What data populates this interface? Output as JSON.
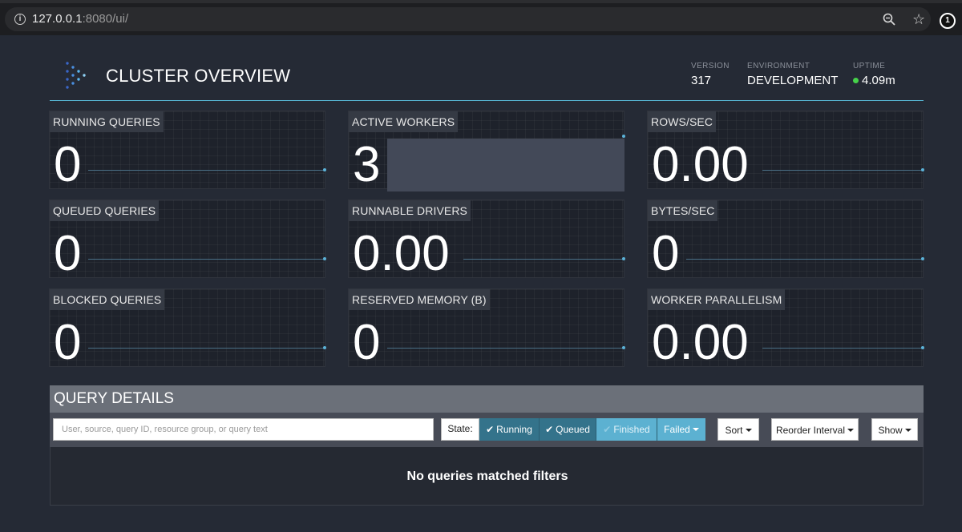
{
  "browser": {
    "url_host": "127.0.0.1",
    "url_rest": ":8080/ui/",
    "info_icon": "info-icon",
    "zoom_icon": "zoom-icon",
    "star_icon": "star-icon",
    "profile_badge": "1"
  },
  "header": {
    "title": "CLUSTER OVERVIEW",
    "version_label": "VERSION",
    "version_value": "317",
    "environment_label": "ENVIRONMENT",
    "environment_value": "DEVELOPMENT",
    "uptime_label": "UPTIME",
    "uptime_value": "4.09m",
    "accent_color": "#57b8d6",
    "uptime_status_color": "#46d24a"
  },
  "stats": [
    {
      "label": "RUNNING QUERIES",
      "value": "0"
    },
    {
      "label": "ACTIVE WORKERS",
      "value": "3"
    },
    {
      "label": "ROWS/SEC",
      "value": "0.00"
    },
    {
      "label": "QUEUED QUERIES",
      "value": "0"
    },
    {
      "label": "RUNNABLE DRIVERS",
      "value": "0.00"
    },
    {
      "label": "BYTES/SEC",
      "value": "0"
    },
    {
      "label": "BLOCKED QUERIES",
      "value": "0"
    },
    {
      "label": "RESERVED MEMORY (B)",
      "value": "0"
    },
    {
      "label": "WORKER PARALLELISM",
      "value": "0.00"
    }
  ],
  "query_details": {
    "title": "QUERY DETAILS",
    "search_placeholder": "User, source, query ID, resource group, or query text",
    "search_value": "",
    "state_label": "State:",
    "state_running": "Running",
    "state_queued": "Queued",
    "state_finished": "Finished",
    "state_failed": "Failed",
    "sort_label": "Sort",
    "reorder_label": "Reorder Interval",
    "show_label": "Show",
    "empty_message": "No queries matched filters"
  }
}
